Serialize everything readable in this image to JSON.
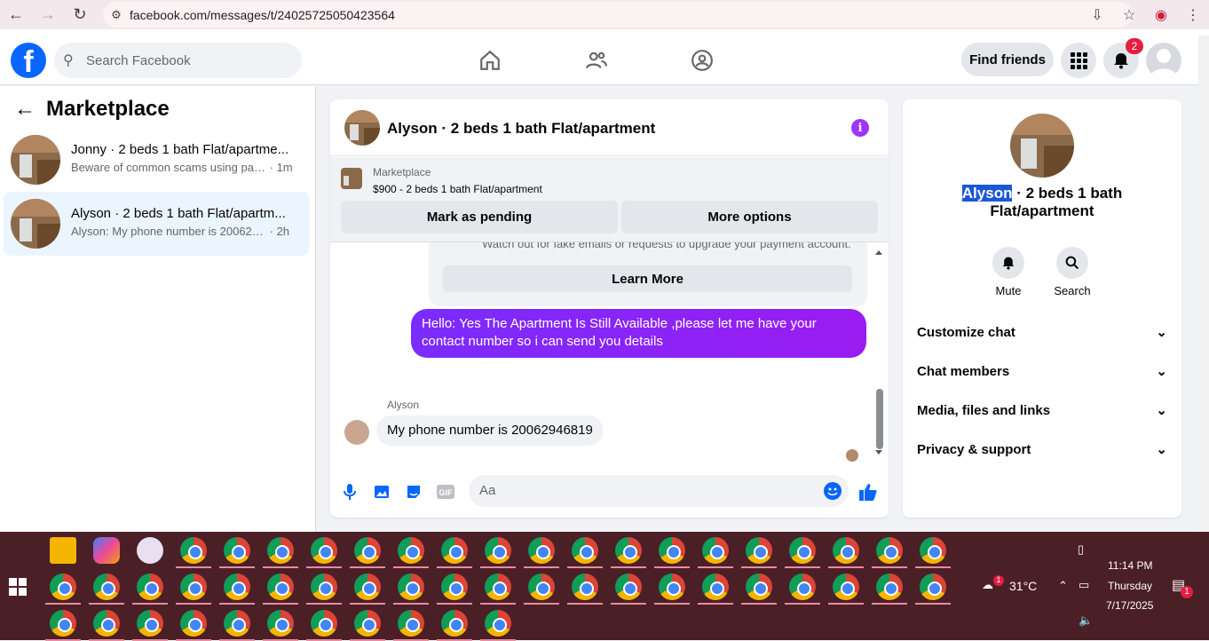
{
  "browser": {
    "url": "facebook.com/messages/t/24025725050423564"
  },
  "header": {
    "logo": "f",
    "search_placeholder": "Search Facebook",
    "find_friends": "Find friends",
    "notification_count": "2"
  },
  "left_pane": {
    "title": "Marketplace",
    "threads": [
      {
        "title": "Jonny · 2 beds 1 bath Flat/apartme...",
        "preview": "Beware of common scams using pay...",
        "time": "· 1m"
      },
      {
        "title": "Alyson · 2 beds 1 bath Flat/apartm...",
        "preview": "Alyson: My phone number is 2006294...",
        "time": "· 2h"
      }
    ]
  },
  "chat": {
    "title": "Alyson · 2 beds 1 bath Flat/apartment",
    "marketplace_label": "Marketplace",
    "listing": "$900 - 2 beds 1 bath Flat/apartment",
    "mark_pending": "Mark as pending",
    "more_options": "More options",
    "notice_text": "Watch out for fake emails or requests to upgrade your payment account.",
    "learn_more": "Learn More",
    "outgoing": "Hello: Yes The Apartment Is Still Available ,please let me have your contact number so i can send you details",
    "sender": "Alyson",
    "incoming": "My phone number is 20062946819",
    "composer_placeholder": "Aa"
  },
  "right_pane": {
    "name_highlight": "Alyson",
    "name_rest": " · 2 beds 1 bath Flat/apartment",
    "mute": "Mute",
    "search": "Search",
    "sections": [
      "Customize chat",
      "Chat members",
      "Media, files and links",
      "Privacy & support"
    ]
  },
  "taskbar": {
    "temperature": "31°C",
    "weather_badge": "1",
    "time": "11:14 PM",
    "day": "Thursday",
    "date": "7/17/2025",
    "notification_badge": "1"
  },
  "colors": {
    "fb_blue": "#0866ff",
    "messenger_purple": "#9a1cf0",
    "taskbar": "#4b1f26"
  }
}
